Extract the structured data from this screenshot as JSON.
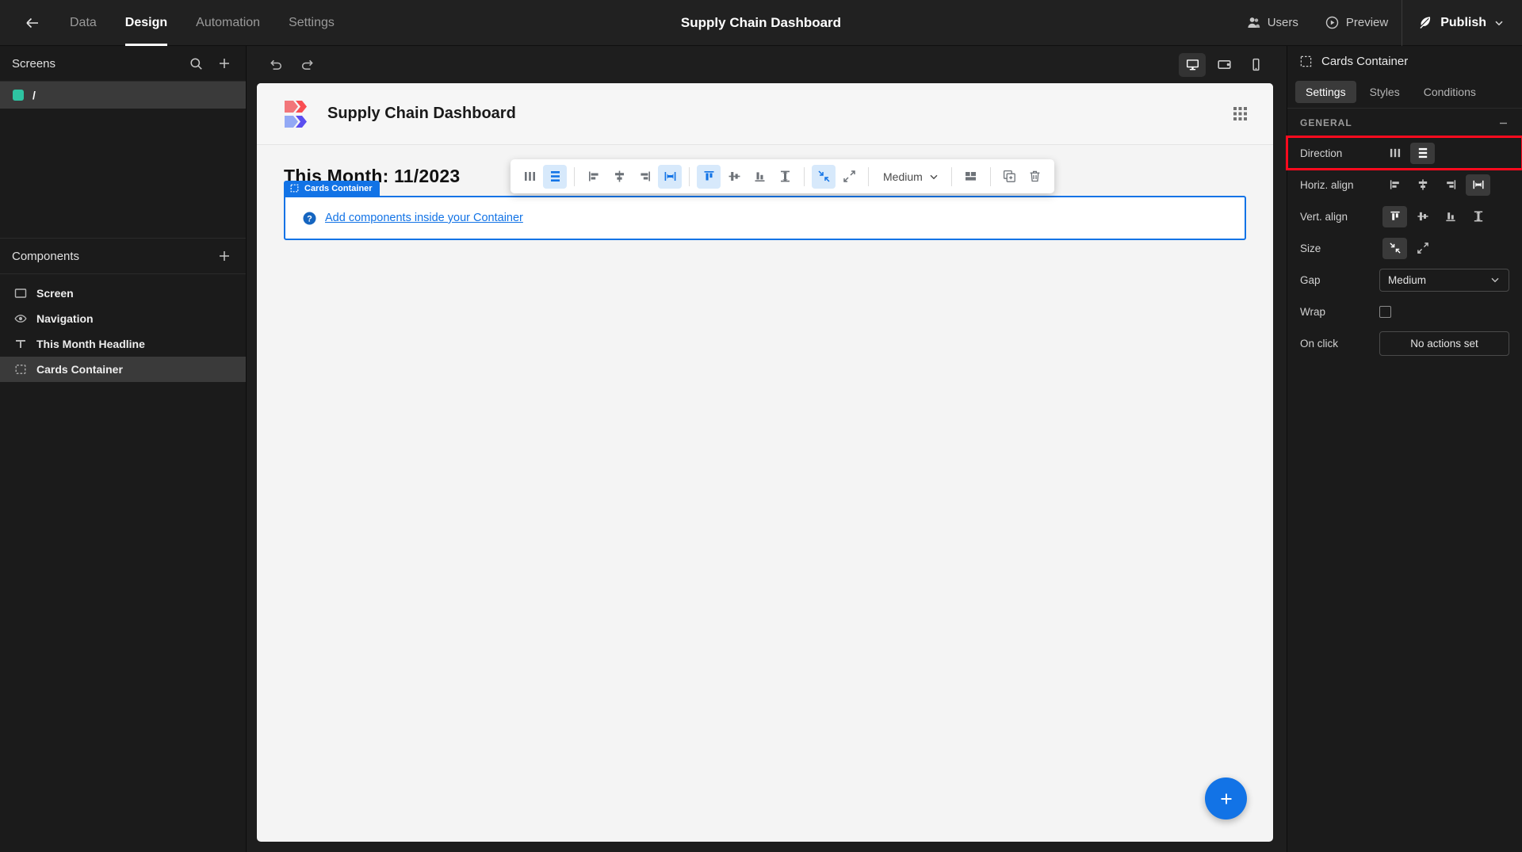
{
  "topbar": {
    "back_icon": "arrow-left-icon",
    "nav": [
      {
        "label": "Data",
        "active": false
      },
      {
        "label": "Design",
        "active": true
      },
      {
        "label": "Automation",
        "active": false
      },
      {
        "label": "Settings",
        "active": false
      }
    ],
    "title": "Supply Chain Dashboard",
    "users_label": "Users",
    "preview_label": "Preview",
    "publish_label": "Publish"
  },
  "sidebar": {
    "screens": {
      "title": "Screens",
      "search_icon": "search-icon",
      "add_icon": "plus-icon",
      "items": [
        {
          "label": "/",
          "selected": true,
          "dot_color": "#2ec4a2"
        }
      ]
    },
    "components": {
      "title": "Components",
      "add_icon": "plus-icon",
      "items": [
        {
          "label": "Screen",
          "icon": "screen-icon",
          "selected": false
        },
        {
          "label": "Navigation",
          "icon": "eye-icon",
          "selected": false
        },
        {
          "label": "This Month Headline",
          "icon": "text-icon",
          "selected": false
        },
        {
          "label": "Cards Container",
          "icon": "container-icon",
          "selected": true
        }
      ]
    }
  },
  "canvas_toolbar": {
    "undo_icon": "undo-icon",
    "redo_icon": "redo-icon",
    "devices": [
      {
        "name": "desktop-icon",
        "active": true
      },
      {
        "name": "tablet-icon",
        "active": false
      },
      {
        "name": "mobile-icon",
        "active": false
      }
    ]
  },
  "canvas": {
    "page_title": "Supply Chain Dashboard",
    "grid_icon": "grid-dots-icon",
    "headline": "This Month: 11/2023",
    "container_badge": "Cards Container",
    "empty_link": "Add components inside your Container",
    "help_icon": "question-circle-icon",
    "fab_icon": "plus-icon"
  },
  "element_toolbar": {
    "buttons": [
      {
        "name": "direction-column-icon",
        "active": false
      },
      {
        "name": "direction-row-icon",
        "active": true
      },
      {
        "name": "align-left-icon",
        "active": false
      },
      {
        "name": "align-center-icon",
        "active": false
      },
      {
        "name": "align-right-icon",
        "active": false
      },
      {
        "name": "align-space-between-icon",
        "active": true
      },
      {
        "name": "valign-top-icon",
        "active": true
      },
      {
        "name": "valign-middle-icon",
        "active": false
      },
      {
        "name": "valign-bottom-icon",
        "active": false
      },
      {
        "name": "valign-stretch-icon",
        "active": false
      },
      {
        "name": "size-shrink-icon",
        "active": true
      },
      {
        "name": "size-expand-icon",
        "active": false
      }
    ],
    "gap_value": "Medium",
    "layout_icon": "layout-icon",
    "duplicate_icon": "duplicate-icon",
    "delete_icon": "trash-icon"
  },
  "rightpanel": {
    "title": "Cards Container",
    "title_icon": "container-icon",
    "tabs": [
      {
        "label": "Settings",
        "active": true
      },
      {
        "label": "Styles",
        "active": false
      },
      {
        "label": "Conditions",
        "active": false
      }
    ],
    "group": {
      "title": "GENERAL",
      "collapse_icon": "minus-icon"
    },
    "rows": {
      "direction": {
        "label": "Direction",
        "options": [
          {
            "name": "direction-column-icon",
            "active": false
          },
          {
            "name": "direction-row-icon",
            "active": true
          }
        ],
        "highlighted": true,
        "highlight_color": "#ff0a1e"
      },
      "horiz_align": {
        "label": "Horiz. align",
        "options": [
          {
            "name": "align-left-icon",
            "active": false
          },
          {
            "name": "align-center-icon",
            "active": false
          },
          {
            "name": "align-right-icon",
            "active": false
          },
          {
            "name": "align-space-between-icon",
            "active": true
          }
        ]
      },
      "vert_align": {
        "label": "Vert. align",
        "options": [
          {
            "name": "valign-top-icon",
            "active": true
          },
          {
            "name": "valign-middle-icon",
            "active": false
          },
          {
            "name": "valign-bottom-icon",
            "active": false
          },
          {
            "name": "valign-stretch-icon",
            "active": false
          }
        ]
      },
      "size": {
        "label": "Size",
        "options": [
          {
            "name": "size-shrink-icon",
            "active": true
          },
          {
            "name": "size-expand-icon",
            "active": false
          }
        ]
      },
      "gap": {
        "label": "Gap",
        "value": "Medium"
      },
      "wrap": {
        "label": "Wrap",
        "checked": false
      },
      "on_click": {
        "label": "On click",
        "value": "No actions set"
      }
    }
  }
}
